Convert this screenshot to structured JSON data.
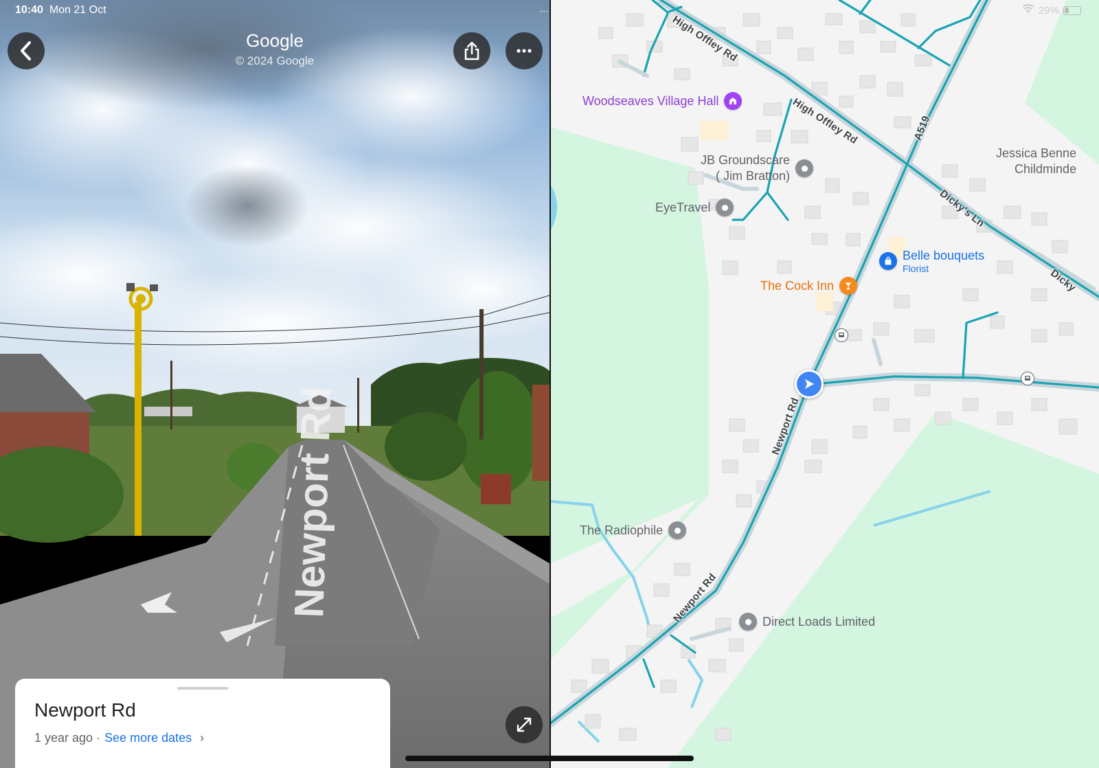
{
  "status_bar": {
    "time": "10:40",
    "date": "Mon 21 Oct",
    "battery": "29%"
  },
  "street_view": {
    "brand": "Google",
    "copyright": "© 2024 Google",
    "road_marking": "Newport Rd",
    "card": {
      "title": "Newport Rd",
      "age": "1 year ago ·",
      "link": "See more dates"
    }
  },
  "map": {
    "roads": {
      "high_offley_1": "High Offley Rd",
      "high_offley_2": "High Offley Rd",
      "a519": "A519",
      "dickys_ln": "Dicky's Ln",
      "dickys_ln_2": "Dicky",
      "newport_1": "Newport Rd",
      "newport_2": "Newport Rd"
    },
    "places": {
      "village_hall": "Woodseaves Village Hall",
      "jb_line1": "JB Groundscare",
      "jb_line2": "( Jim Bratton)",
      "eyetravel": "EyeTravel",
      "jessica_line1": "Jessica Benne",
      "jessica_line2": "Childminde",
      "belle": "Belle bouquets",
      "belle_sub": "Florist",
      "cock_inn": "The Cock Inn",
      "radiophile": "The Radiophile",
      "direct_loads": "Direct Loads Limited"
    },
    "colors": {
      "road": "#1aa3b2",
      "park": "#d4f5e0",
      "water": "#86d3ea",
      "village_hall": "#8a3fd1",
      "cock_inn": "#e8710a",
      "belle": "#1a73e8",
      "location": "#4285f4"
    }
  }
}
